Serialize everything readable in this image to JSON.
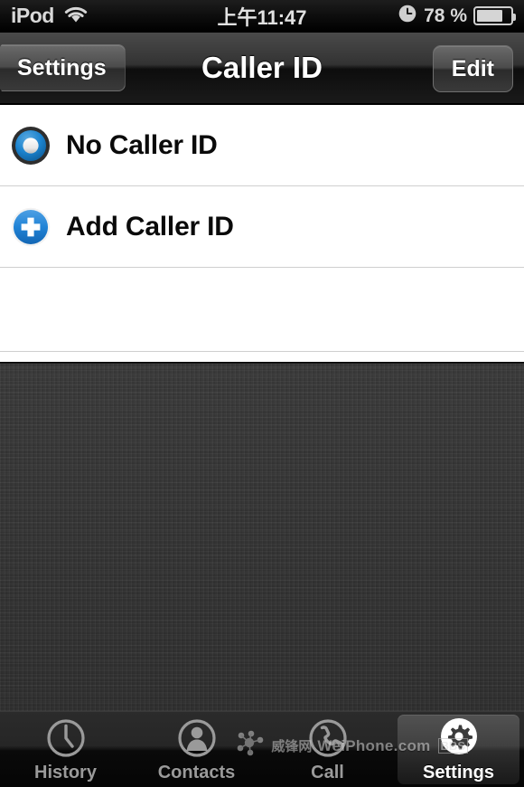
{
  "status_bar": {
    "carrier": "iPod",
    "wifi_icon": "wifi-icon",
    "time": "上午11:47",
    "alarm_icon": "alarm-clock-icon",
    "battery_percent": "78 %",
    "battery_level": 70,
    "battery_icon": "battery-icon"
  },
  "nav_bar": {
    "back_label": "Settings",
    "title": "Caller ID",
    "edit_label": "Edit"
  },
  "list": {
    "rows": [
      {
        "label": "No Caller ID",
        "icon": "radio-selected-icon"
      },
      {
        "label": "Add Caller ID",
        "icon": "plus-circle-icon"
      }
    ]
  },
  "tab_bar": {
    "items": [
      {
        "label": "History",
        "icon": "clock-icon",
        "selected": false
      },
      {
        "label": "Contacts",
        "icon": "person-icon",
        "selected": false
      },
      {
        "label": "Call",
        "icon": "phone-icon",
        "selected": false
      },
      {
        "label": "Settings",
        "icon": "gear-icon",
        "selected": true
      }
    ]
  },
  "watermark": {
    "cn_text": "威锋网",
    "text": "WeiPhone.com",
    "badge": "BBS",
    "logo_icon": "weiphone-molecule-icon"
  },
  "colors": {
    "accent_blue": "#1a7fd4",
    "nav_dark": "#2b2b2b",
    "linen": "#343434",
    "list_bg": "#ffffff",
    "separator": "#cfcfcf"
  }
}
